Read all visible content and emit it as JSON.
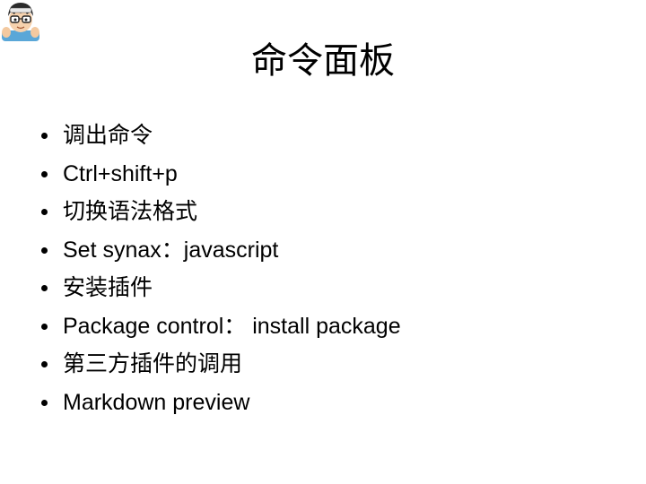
{
  "slide": {
    "title": "命令面板",
    "bullets": [
      "调出命令",
      "Ctrl+shift+p",
      "切换语法格式",
      "Set synax：javascript",
      "安装插件",
      "Package control： install package",
      "第三方插件的调用",
      "Markdown preview"
    ]
  },
  "avatar": {
    "icon": "cartoon-avatar-icon"
  }
}
